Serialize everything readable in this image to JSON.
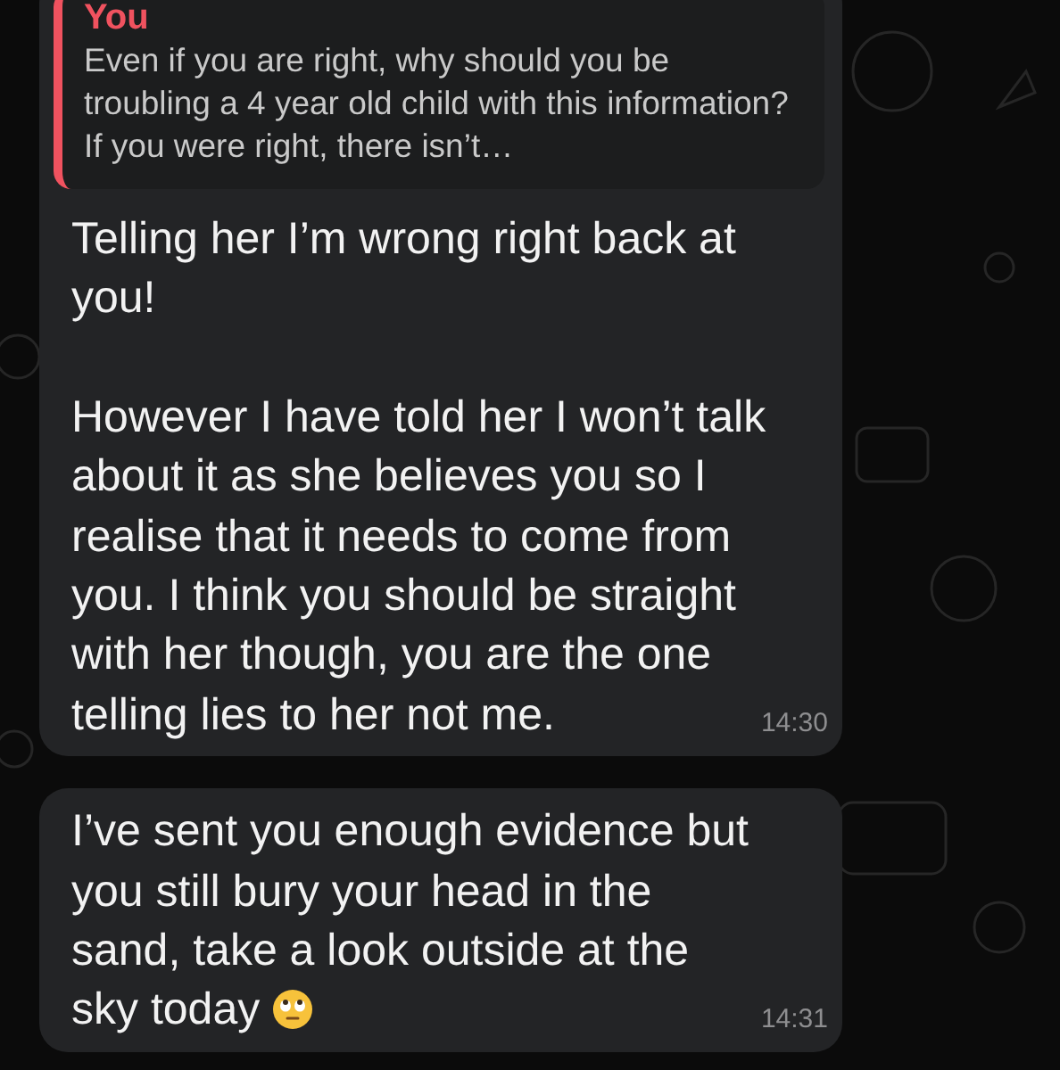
{
  "messages": [
    {
      "quote": {
        "author": "You",
        "text": "Even if you are right, why should you be troubling a 4 year old child with this information? If you were right, there isn’t…"
      },
      "paragraphs": [
        "Telling her I’m wrong right back at you!",
        "However I have told her I won’t talk about it as she believes you so I realise that it needs to come from you. I think you should be straight with her though, you are the one telling lies to her not me."
      ],
      "time": "14:30",
      "emoji": false
    },
    {
      "paragraphs": [
        "I’ve sent you enough evidence but you still bury your head in the sand, take a look outside at the sky today"
      ],
      "time": "14:31",
      "emoji": true
    }
  ]
}
